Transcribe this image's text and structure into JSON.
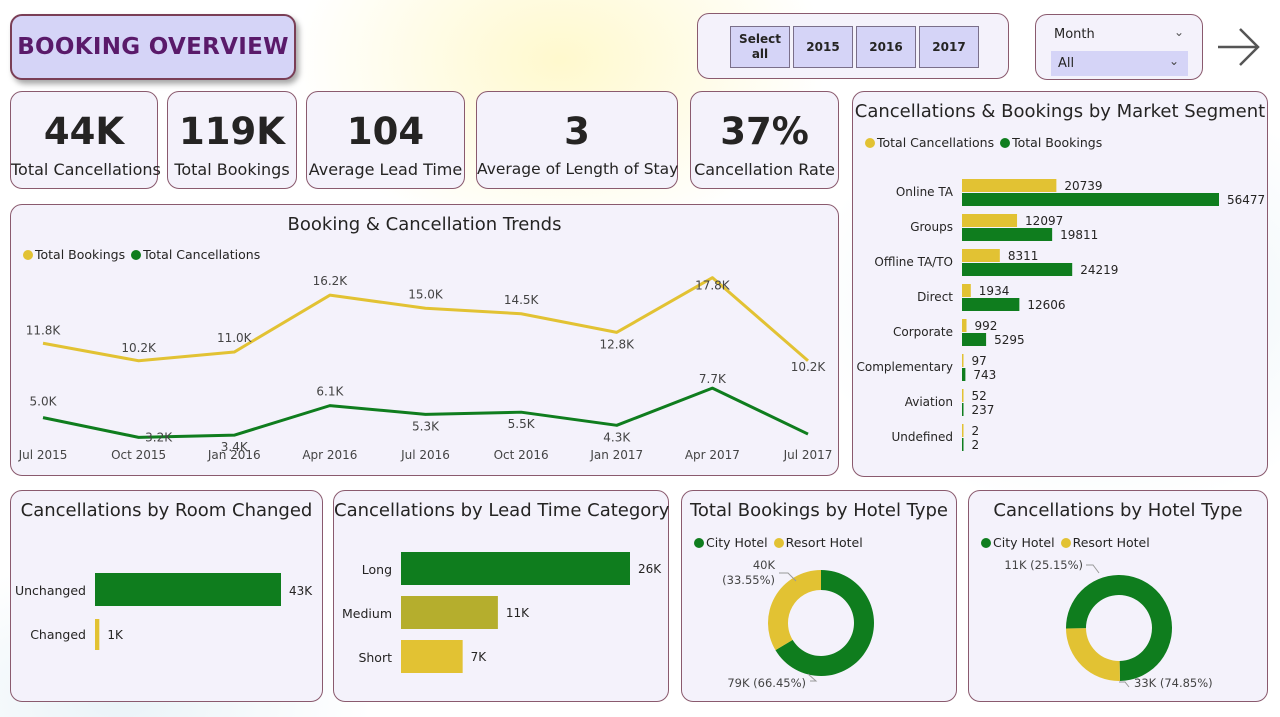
{
  "header": {
    "title": "BOOKING OVERVIEW"
  },
  "year_slicer": {
    "buttons": [
      {
        "label_line1": "Select",
        "label_line2": "all"
      },
      {
        "label_line1": "2015",
        "label_line2": ""
      },
      {
        "label_line1": "2016",
        "label_line2": ""
      },
      {
        "label_line1": "2017",
        "label_line2": ""
      }
    ]
  },
  "month_slicer": {
    "label": "Month",
    "selected": "All"
  },
  "colors": {
    "yellow": "#e2c233",
    "green": "#0f7d1e",
    "olive": "#b5ae2d",
    "card_bg": "#f4f2fb",
    "card_border": "#8a5a6e",
    "title_bg": "#d5d4f7"
  },
  "kpis": [
    {
      "value": "44K",
      "label": "Total Cancellations"
    },
    {
      "value": "119K",
      "label": "Total Bookings"
    },
    {
      "value": "104",
      "label": "Average Lead Time"
    },
    {
      "value": "3",
      "label": "Average of Length of Stay"
    },
    {
      "value": "37%",
      "label": "Cancellation Rate"
    }
  ],
  "chart_data": [
    {
      "id": "trends",
      "type": "line",
      "title": "Booking & Cancellation Trends",
      "legend": [
        "Total Bookings",
        "Total Cancellations"
      ],
      "categories": [
        "Jul 2015",
        "Oct 2015",
        "Jan 2016",
        "Apr 2016",
        "Jul 2016",
        "Oct 2016",
        "Jan 2017",
        "Apr 2017",
        "Jul 2017"
      ],
      "series": [
        {
          "name": "Total Bookings",
          "color": "#e2c233",
          "values": [
            11800,
            10200,
            11000,
            16200,
            15000,
            14500,
            12800,
            17800,
            10200
          ],
          "labels": [
            "11.8K",
            "10.2K",
            "11.0K",
            "16.2K",
            "15.0K",
            "14.5K",
            "12.8K",
            "17.8K",
            "10.2K"
          ]
        },
        {
          "name": "Total Cancellations",
          "color": "#0f7d1e",
          "values": [
            5000,
            3200,
            3400,
            6100,
            5300,
            5500,
            4300,
            7700,
            3500
          ],
          "labels": [
            "5.0K",
            "3.2K",
            "3.4K",
            "6.1K",
            "5.3K",
            "5.5K",
            "4.3K",
            "7.7K",
            ""
          ]
        }
      ]
    },
    {
      "id": "segment",
      "type": "bar",
      "title": "Cancellations & Bookings by Market Segment",
      "legend": [
        "Total Cancellations",
        "Total Bookings"
      ],
      "categories": [
        "Online TA",
        "Groups",
        "Offline TA/TO",
        "Direct",
        "Corporate",
        "Complementary",
        "Aviation",
        "Undefined"
      ],
      "series": [
        {
          "name": "Total Cancellations",
          "color": "#e2c233",
          "values": [
            20739,
            12097,
            8311,
            1934,
            992,
            97,
            52,
            2
          ]
        },
        {
          "name": "Total Bookings",
          "color": "#0f7d1e",
          "values": [
            56477,
            19811,
            24219,
            12606,
            5295,
            743,
            237,
            2
          ]
        }
      ]
    },
    {
      "id": "room",
      "type": "bar",
      "title": "Cancellations by Room Changed",
      "categories": [
        "Unchanged",
        "Changed"
      ],
      "values": [
        43,
        1
      ],
      "labels": [
        "43K",
        "1K"
      ],
      "colors": [
        "#0f7d1e",
        "#e2c233"
      ]
    },
    {
      "id": "leadtime",
      "type": "bar",
      "title": "Cancellations by Lead Time Category",
      "categories": [
        "Long",
        "Medium",
        "Short"
      ],
      "values": [
        26,
        11,
        7
      ],
      "labels": [
        "26K",
        "11K",
        "7K"
      ],
      "colors": [
        "#0f7d1e",
        "#b5ae2d",
        "#e2c233"
      ]
    },
    {
      "id": "bookings_hotel",
      "type": "pie",
      "title": "Total Bookings by Hotel Type",
      "legend": [
        "City Hotel",
        "Resort Hotel"
      ],
      "slices": [
        {
          "name": "City Hotel",
          "value": 66.45,
          "label_line1": "79K (66.45%)",
          "label_line2": "",
          "color": "#0f7d1e"
        },
        {
          "name": "Resort Hotel",
          "value": 33.55,
          "label_line1": "40K",
          "label_line2": "(33.55%)",
          "color": "#e2c233"
        }
      ]
    },
    {
      "id": "cancel_hotel",
      "type": "pie",
      "title": "Cancellations by Hotel Type",
      "legend": [
        "City Hotel",
        "Resort Hotel"
      ],
      "slices": [
        {
          "name": "City Hotel",
          "value": 74.85,
          "label_line1": "33K (74.85%)",
          "label_line2": "",
          "color": "#0f7d1e"
        },
        {
          "name": "Resort Hotel",
          "value": 25.15,
          "label_line1": "11K (25.15%)",
          "label_line2": "",
          "color": "#e2c233"
        }
      ]
    }
  ]
}
